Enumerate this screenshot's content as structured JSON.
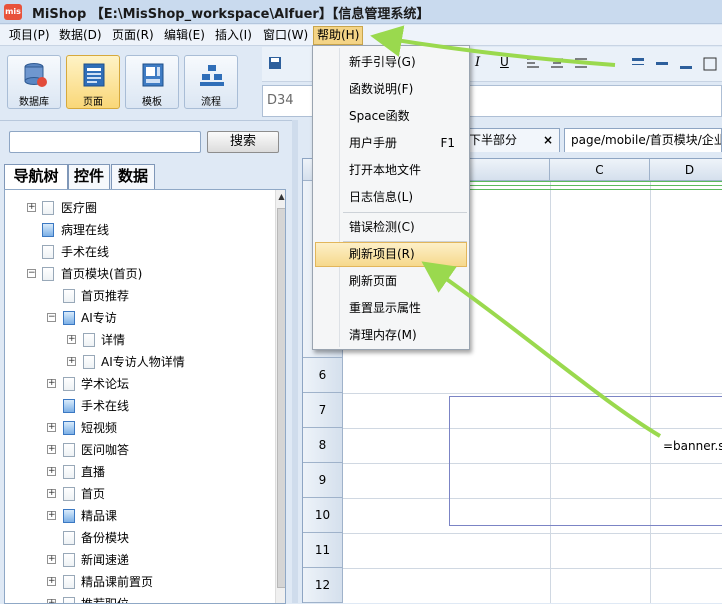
{
  "window": {
    "title": "MiShop 【E:\\MisShop_workspace\\Alfuer】【信息管理系统】",
    "logo": "mis"
  },
  "menubar": {
    "items": [
      "项目(P)",
      "数据(D)",
      "页面(R)",
      "编辑(E)",
      "插入(I)",
      "窗口(W)",
      "帮助(H)"
    ]
  },
  "toolbar": {
    "buttons": [
      {
        "label": "数据库",
        "icon": "database-icon"
      },
      {
        "label": "页面",
        "icon": "page-icon"
      },
      {
        "label": "模板",
        "icon": "template-icon"
      },
      {
        "label": "流程",
        "icon": "flow-icon"
      }
    ]
  },
  "formula": {
    "cell_ref": "D34"
  },
  "left_panel": {
    "search_placeholder": "",
    "search_button": "搜索",
    "tabs": [
      "导航树",
      "控件",
      "数据"
    ]
  },
  "tree": [
    "医疗圈",
    "病理在线",
    "手术在线",
    "首页模块(首页)",
    "首页推荐",
    "AI专访",
    "详情",
    "AI专访人物详情",
    "学术论坛",
    "手术在线",
    "短视频",
    "医问咖答",
    "直播",
    "首页",
    "精品课",
    "备份模块",
    "新闻速递",
    "精品课前置页",
    "推荐职位"
  ],
  "sheet": {
    "tabs": [
      "专栏下半部分",
      "page/mobile/首页模块/企业"
    ],
    "tab_close": "×",
    "columns": [
      "B",
      "C",
      "D"
    ],
    "rows": [
      "6",
      "7",
      "8",
      "9",
      "10",
      "11",
      "12"
    ],
    "cell_text": "=banner.s"
  },
  "help_menu": {
    "items": [
      {
        "label": "新手引导(G)",
        "shortcut": ""
      },
      {
        "label": "函数说明(F)",
        "shortcut": ""
      },
      {
        "label": "Space函数",
        "shortcut": ""
      },
      {
        "label": "用户手册",
        "shortcut": "F1"
      },
      {
        "label": "打开本地文件",
        "shortcut": ""
      },
      {
        "label": "日志信息(L)",
        "shortcut": ""
      },
      {
        "label": "错误检测(C)",
        "shortcut": ""
      },
      {
        "label": "刷新项目(R)",
        "shortcut": ""
      },
      {
        "label": "刷新页面",
        "shortcut": ""
      },
      {
        "label": "重置显示属性",
        "shortcut": ""
      },
      {
        "label": "清理内存(M)",
        "shortcut": ""
      }
    ],
    "highlighted": "刷新项目(R)"
  },
  "colors": {
    "arrow": "#9ad94e",
    "highlight": "#f6d98c",
    "menu_active": "#f4d486"
  }
}
